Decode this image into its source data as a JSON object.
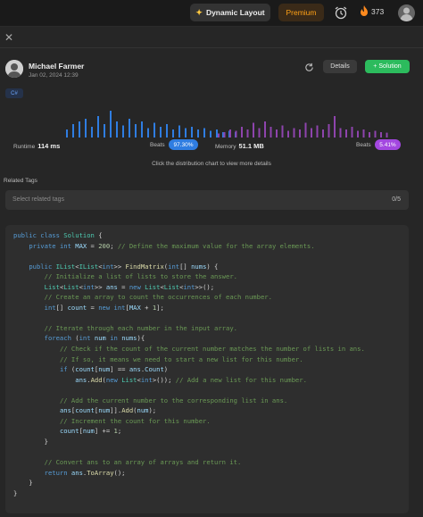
{
  "topbar": {
    "dynamic_layout_label": "Dynamic Layout",
    "premium_label": "Premium",
    "streak_count": "373"
  },
  "post": {
    "author_name": "Michael Farmer",
    "date": "Jan 02, 2024 12:39",
    "details_label": "Details",
    "solution_label": "Solution",
    "language_tag": "C#"
  },
  "stats": {
    "runtime_label": "Runtime",
    "runtime_value": "114 ms",
    "runtime_beats_label": "Beats",
    "runtime_beats_value": "97.30%",
    "memory_label": "Memory",
    "memory_value": "51.1 MB",
    "memory_beats_label": "Beats",
    "memory_beats_value": "5.41%",
    "hint": "Click the distribution chart to view more details",
    "runtime_bars": [
      0.3,
      0.5,
      0.6,
      0.7,
      0.4,
      0.8,
      0.5,
      1.0,
      0.6,
      0.45,
      0.7,
      0.5,
      0.6,
      0.35,
      0.55,
      0.4,
      0.5,
      0.3,
      0.45,
      0.35,
      0.4,
      0.3,
      0.35,
      0.25,
      0.3,
      0.2,
      0.25,
      0.2
    ],
    "memory_bars": [
      0.15,
      0.2,
      0.3,
      0.25,
      0.4,
      0.3,
      0.55,
      0.35,
      0.6,
      0.4,
      0.3,
      0.45,
      0.25,
      0.35,
      0.3,
      0.55,
      0.35,
      0.45,
      0.3,
      0.5,
      0.8,
      0.35,
      0.3,
      0.4,
      0.25,
      0.3,
      0.2,
      0.25,
      0.2,
      0.18
    ],
    "colors": {
      "runtime_bar": "#2f7de1",
      "memory_bar": "#8e44ad",
      "runtime_pill": "#2f7de1",
      "memory_pill": "#a347e0"
    }
  },
  "tags": {
    "section_label": "Related Tags",
    "placeholder": "Select related tags",
    "count": "0/5"
  }
}
